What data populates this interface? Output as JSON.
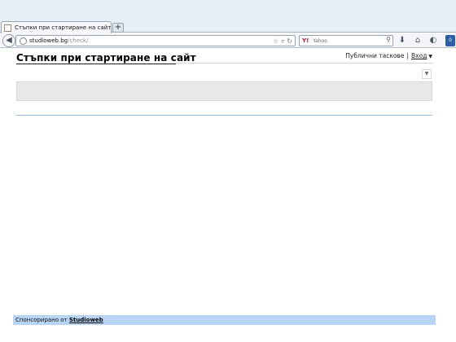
{
  "browser": {
    "tab_title": "Стъпки при стартиране на сайт",
    "new_tab_label": "+",
    "url_host": "studioweb.bg",
    "url_path": "/check/",
    "search_engine_logo": "Y!",
    "search_placeholder": "Yahoo",
    "icons": [
      "back-icon",
      "globe-icon",
      "star-icon",
      "dropdown-icon",
      "reload-icon",
      "search-icon",
      "download-icon",
      "home-icon",
      "sync-icon",
      "addon-icon"
    ],
    "addon_count": "0"
  },
  "page": {
    "title": "Стъпки при стартиране на сайт",
    "public_tasks_link": "Публични таскове",
    "separator": "|",
    "login_link": "Вход",
    "login_caret": "▼"
  },
  "footer": {
    "sponsored_text": "Спонсорирано от",
    "sponsor_link": "Studioweb"
  }
}
